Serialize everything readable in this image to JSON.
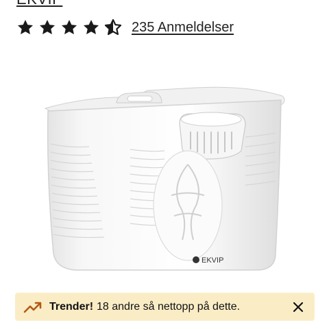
{
  "brand": {
    "label": "EKVIP"
  },
  "rating": {
    "value": 4.5,
    "max": 5,
    "review_count_label": "235 Anmeldelser"
  },
  "product_image": {
    "logo_text": "EKVIP",
    "icon": "bathtub-product-image"
  },
  "trend_banner": {
    "icon": "trending-up-icon",
    "title": "Trender!",
    "message": "18 andre så nettopp på dette.",
    "close_icon": "close-icon",
    "background": "#faedc6",
    "icon_color": "#b35a12"
  },
  "colors": {
    "star": "#1a1a1a",
    "text": "#222222"
  }
}
